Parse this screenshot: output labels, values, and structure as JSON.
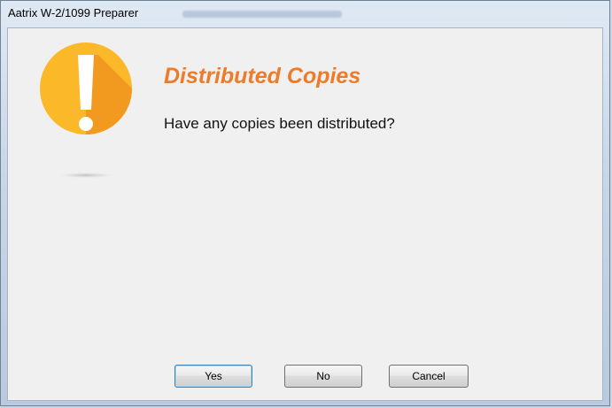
{
  "window": {
    "title": "Aatrix W-2/1099 Preparer"
  },
  "dialog": {
    "icon": "warning-exclamation-icon",
    "heading": "Distributed Copies",
    "question": "Have any copies been distributed?",
    "accent_color": "#ee7b2a",
    "icon_color": "#fbb829"
  },
  "buttons": {
    "yes_label": "Yes",
    "no_label": "No",
    "cancel_label": "Cancel"
  }
}
